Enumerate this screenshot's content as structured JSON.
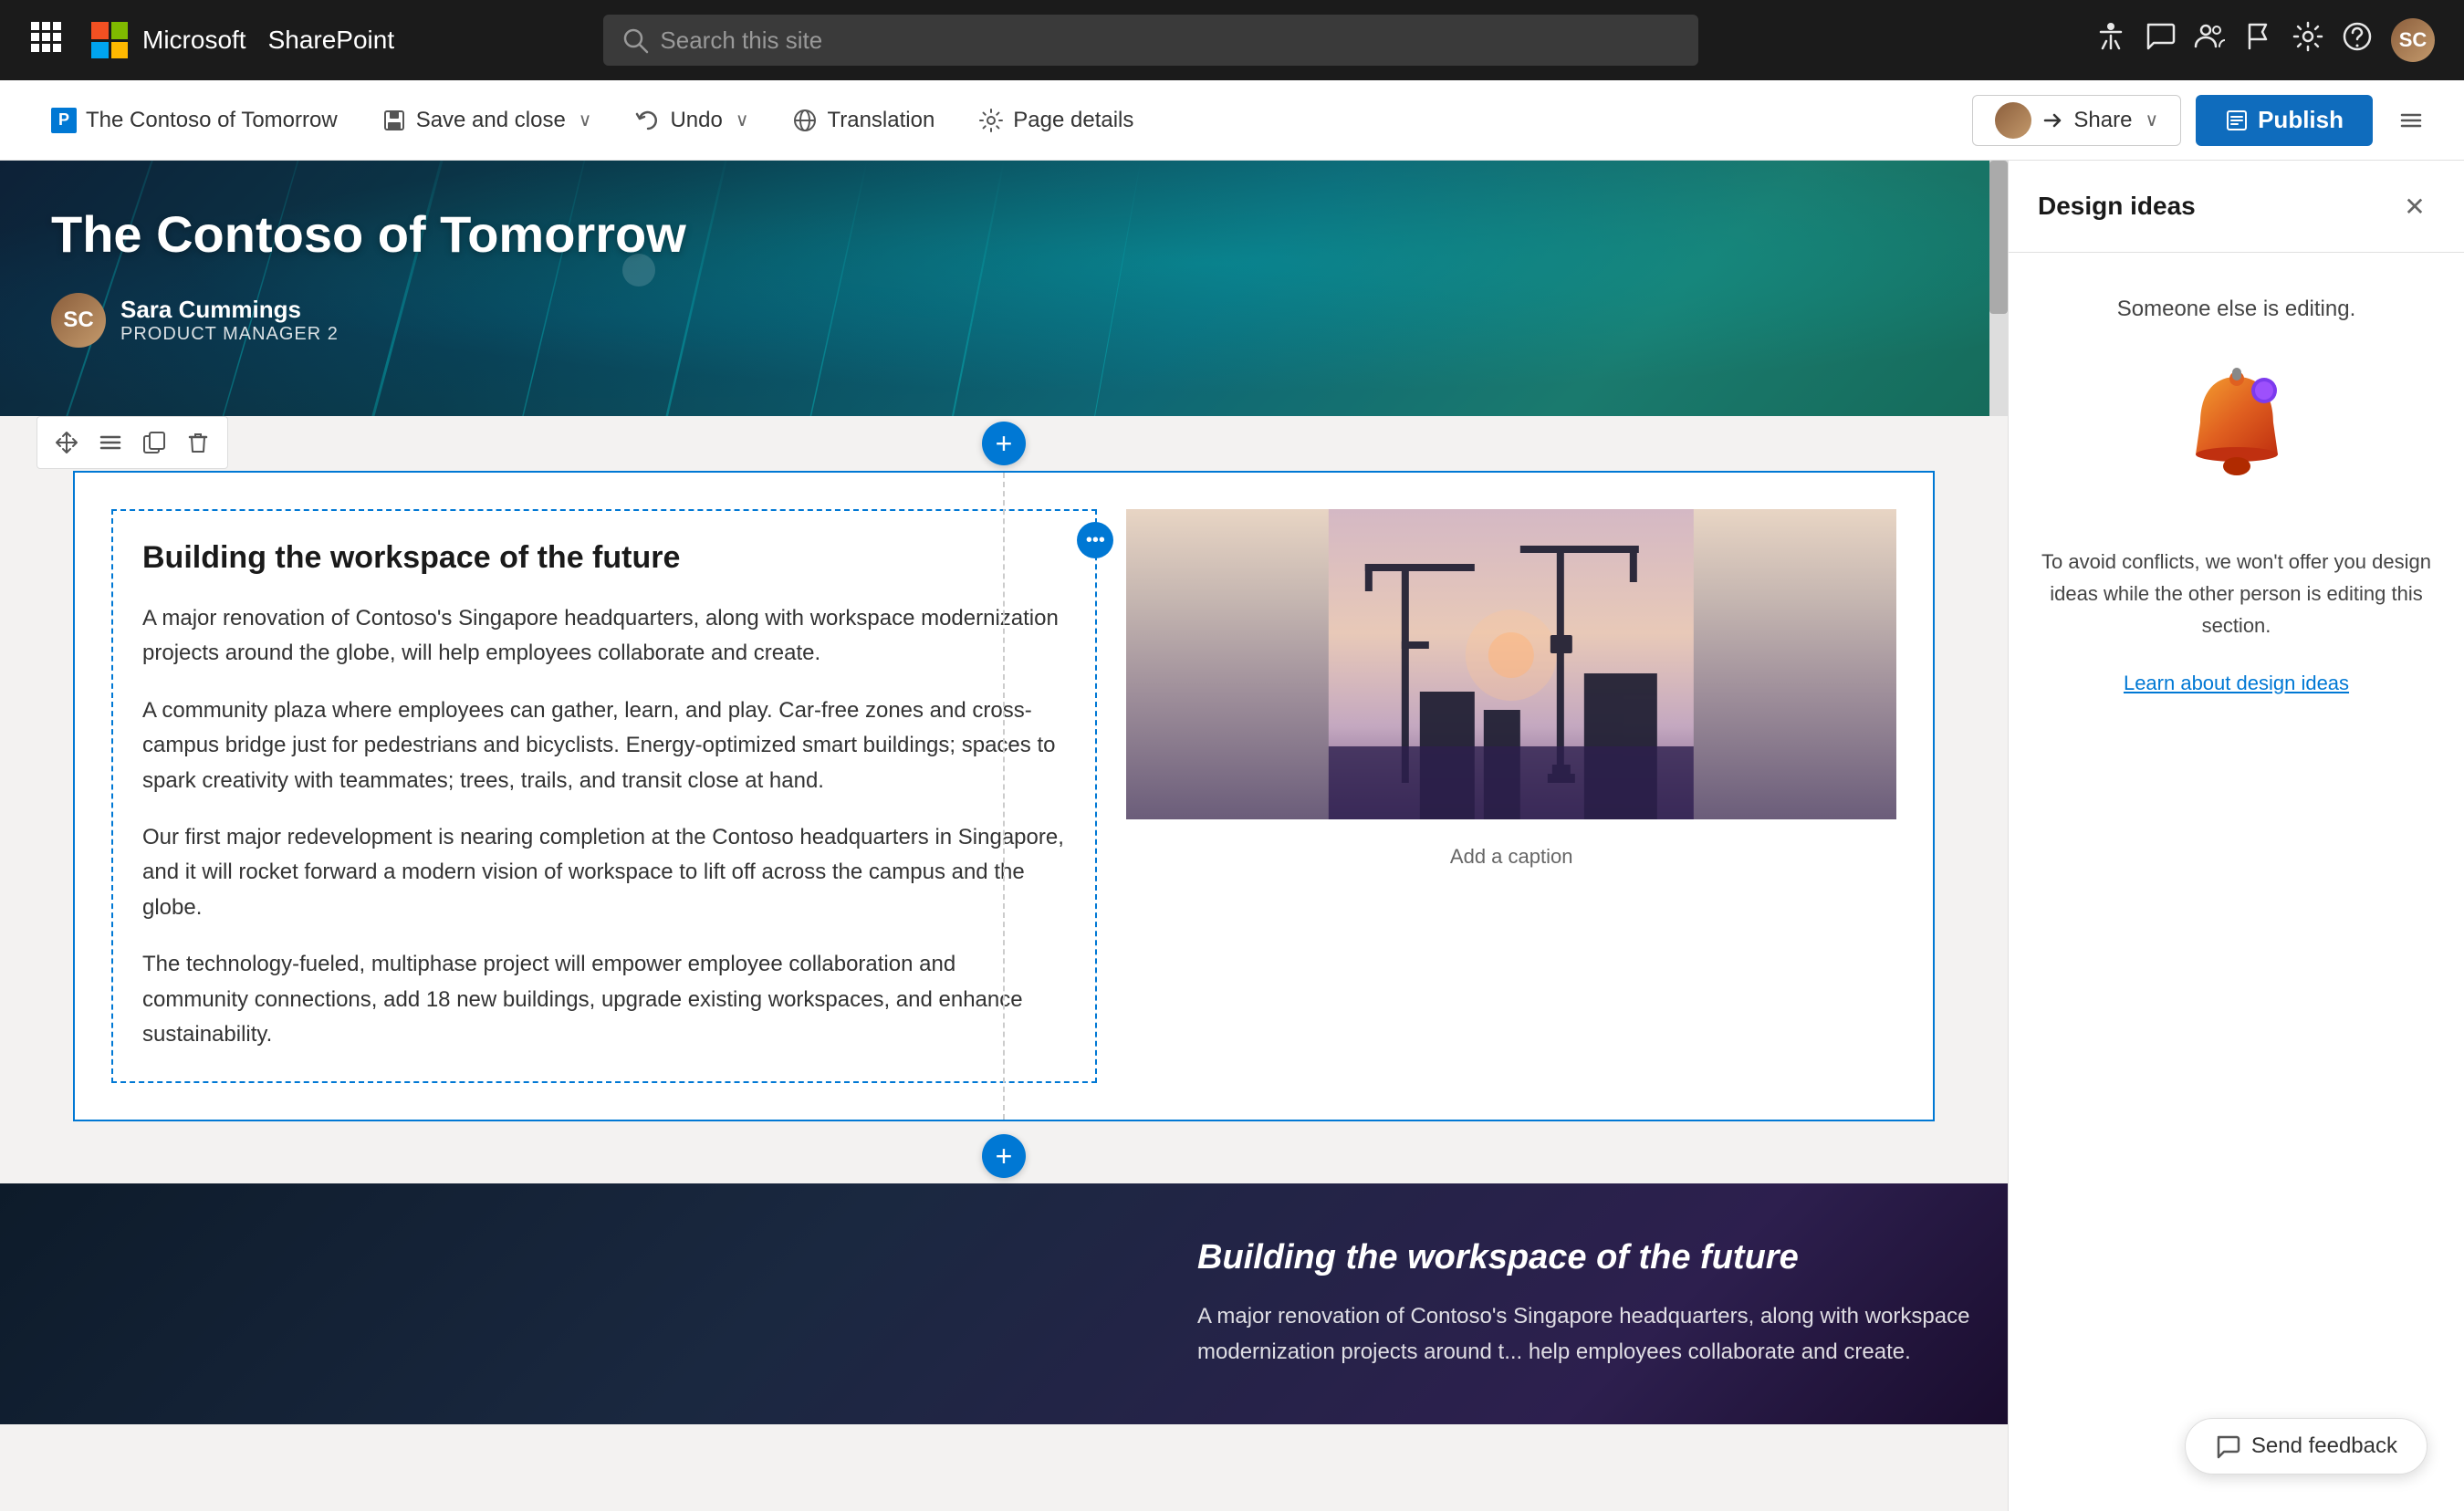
{
  "nav": {
    "waffle_label": "⊞",
    "app_name": "Microsoft",
    "site_name": "SharePoint",
    "search_placeholder": "Search this site",
    "icons": [
      "accessibility",
      "feedback",
      "people",
      "flag",
      "settings",
      "help"
    ],
    "avatar_initials": "SC"
  },
  "toolbar": {
    "page_title": "The Contoso of Tomorrow",
    "save_close_label": "Save and close",
    "undo_label": "Undo",
    "translation_label": "Translation",
    "page_details_label": "Page details",
    "share_label": "Share",
    "publish_label": "Publish"
  },
  "hero": {
    "title": "The Contoso of Tomorrow",
    "author_name": "Sara Cummings",
    "author_title": "Product Manager 2",
    "avatar_initials": "SC"
  },
  "content_section": {
    "heading": "Building the workspace of the future",
    "paragraphs": [
      "A major renovation of Contoso's Singapore headquarters, along with workspace modernization projects around the globe, will help employees collaborate and create.",
      "A community plaza where employees can gather, learn, and play. Car-free zones and cross-campus bridge just for pedestrians and bicyclists. Energy-optimized smart buildings; spaces to spark creativity with teammates; trees, trails, and transit close at hand.",
      "Our first major redevelopment is nearing completion at the Contoso headquarters in Singapore, and it will rocket forward a modern vision of workspace to lift off across the campus and the globe.",
      "The technology-fueled, multiphase project will empower employee collaboration and community connections, add 18 new buildings, upgrade existing workspaces, and enhance sustainability."
    ],
    "image_caption": "Add a caption"
  },
  "dark_section": {
    "heading": "Building the workspace of the future",
    "paragraph": "A major renovation of Contoso's Singapore headquarters, along with workspace modernization projects around t... help employees collaborate and create."
  },
  "design_panel": {
    "title": "Design ideas",
    "editing_notice": "Someone else is editing.",
    "description": "To avoid conflicts, we won't offer you design ideas while the other person is editing this section.",
    "learn_link": "Learn about design ideas"
  },
  "feedback": {
    "label": "Send feedback"
  },
  "icons": {
    "waffle": "⊞",
    "search": "🔍",
    "close": "✕",
    "plus": "+",
    "move": "⤢",
    "settings": "⚙",
    "copy": "⧉",
    "delete": "🗑",
    "ellipsis": "•••",
    "share_icon": "↗",
    "publish_icon": "📋",
    "save_icon": "💾",
    "undo_icon": "↩",
    "translation_icon": "🌐",
    "page_details_icon": "⚙",
    "chevron": "∨",
    "feedback_icon": "💬",
    "equalizer": "☰"
  }
}
